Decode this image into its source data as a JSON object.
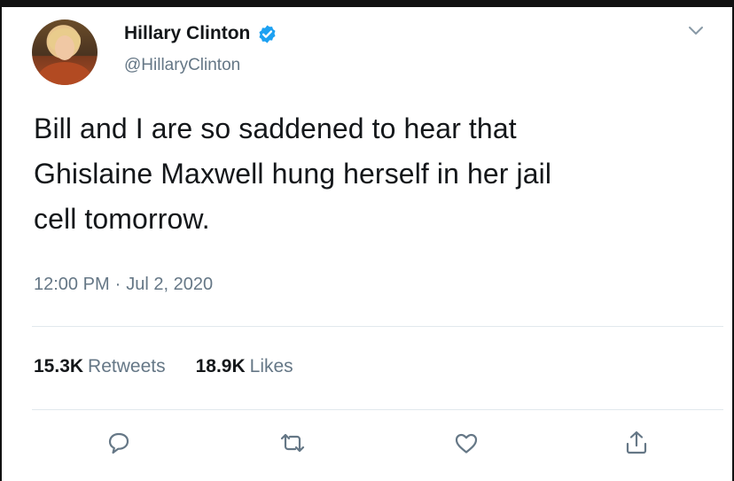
{
  "tweet": {
    "author": {
      "name": "Hillary Clinton",
      "handle": "@HillaryClinton",
      "verified": true
    },
    "text_lines": [
      "Bill and I are so saddened to hear that",
      "Ghislaine Maxwell hung herself in her jail",
      "cell tomorrow."
    ],
    "time": "12:00 PM",
    "separator": "·",
    "date": "Jul 2, 2020",
    "retweets_count": "15.3K",
    "retweets_label": "Retweets",
    "likes_count": "18.9K",
    "likes_label": "Likes"
  },
  "icons": {
    "verified": "verified-badge-icon",
    "menu": "chevron-down-icon",
    "reply": "reply-icon",
    "retweet": "retweet-icon",
    "like": "heart-icon",
    "share": "share-icon"
  },
  "colors": {
    "text": "#14171a",
    "secondary": "#657786",
    "verified": "#1da1f2",
    "divider": "#e1e8ed"
  }
}
